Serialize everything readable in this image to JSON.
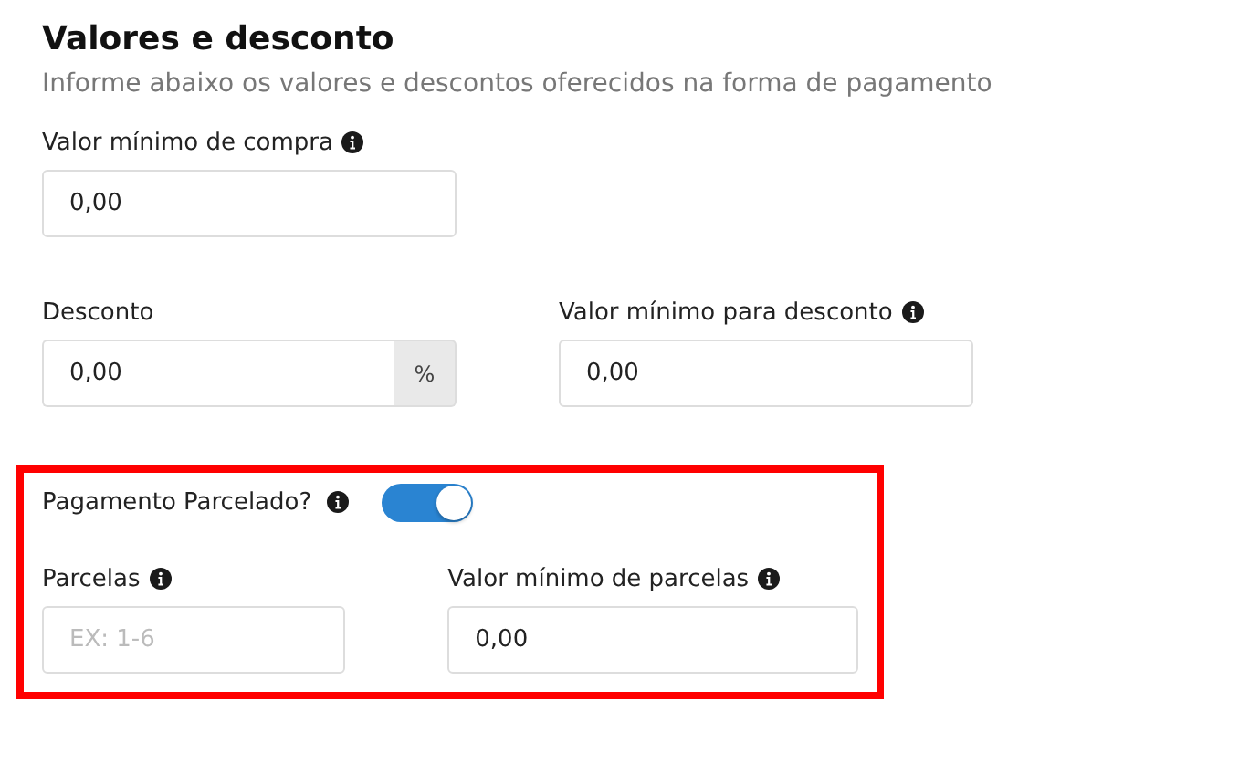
{
  "section": {
    "title": "Valores e desconto",
    "subtitle": "Informe abaixo os valores e descontos oferecidos na forma de pagamento"
  },
  "rows": [
    {
      "fields": [
        {
          "label": "Valor mínimo de compra",
          "info": true,
          "value": "0,00"
        }
      ]
    },
    {
      "fields": [
        {
          "label": "Desconto",
          "info": false,
          "value": "0,00",
          "suffix": "%"
        },
        {
          "label": "Valor mínimo para desconto",
          "info": true,
          "value": "0,00"
        }
      ]
    }
  ],
  "installments": {
    "highlighted": true,
    "toggle": {
      "label": "Pagamento Parcelado?",
      "info": true,
      "on": true
    },
    "fields": [
      {
        "label": "Parcelas",
        "info": true,
        "placeholder": "EX: 1-6"
      },
      {
        "label": "Valor mínimo de parcelas",
        "info": true,
        "value": "0,00"
      }
    ]
  }
}
